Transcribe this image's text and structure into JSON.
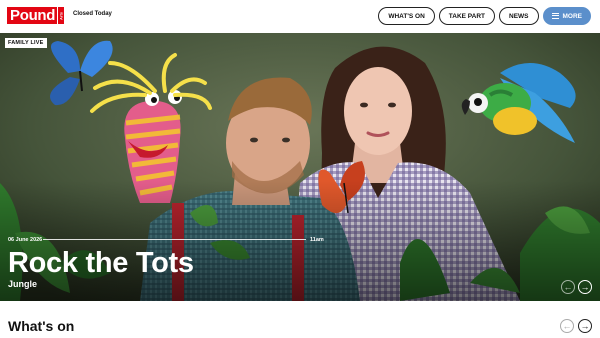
{
  "header": {
    "logo_text": "Pound",
    "logo_tag": "Arts",
    "status": "Closed Today",
    "nav": {
      "whats_on": "WHAT'S ON",
      "take_part": "TAKE PART",
      "news": "NEWS",
      "more": "MORE"
    }
  },
  "hero": {
    "badge": "FAMILY LIVE",
    "date": "06 June 2026",
    "time": "11am",
    "title": "Rock the Tots",
    "subtitle": "Jungle",
    "icons": {
      "prev": "arrow-left-icon",
      "next": "arrow-right-icon"
    }
  },
  "section": {
    "title": "What's on"
  },
  "colors": {
    "brand_red": "#e30613",
    "more_button": "#5b8fcb"
  }
}
